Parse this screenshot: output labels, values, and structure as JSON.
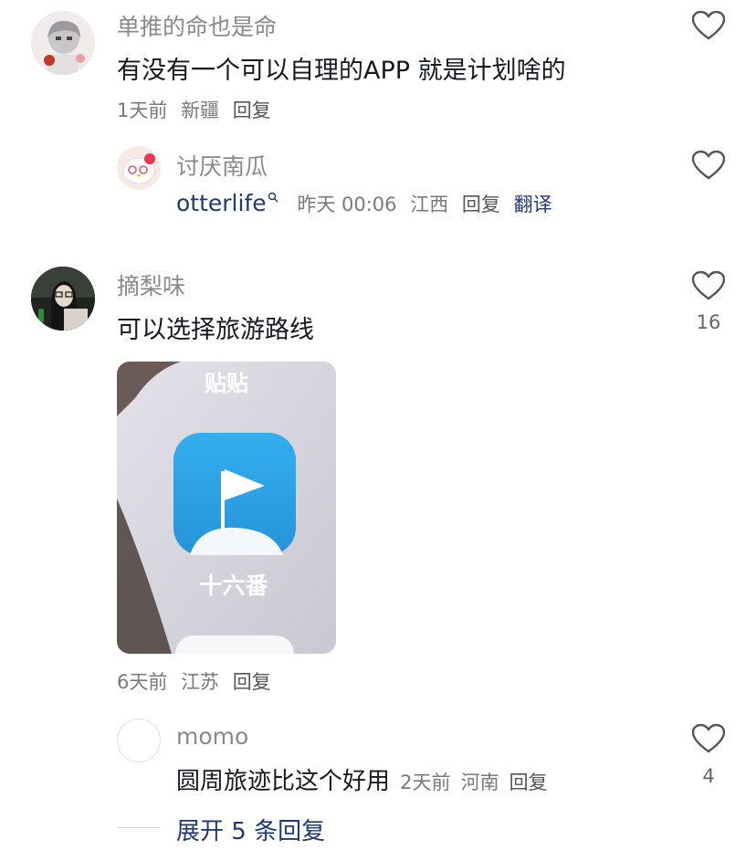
{
  "comments": [
    {
      "username": "单推的命也是命",
      "text": "有没有一个可以自理的APP 就是计划啥的",
      "time": "1天前",
      "location": "新疆",
      "reply_label": "回复",
      "reply": {
        "username": "讨厌南瓜",
        "mention": "otterlife",
        "time": "昨天 00:06",
        "location": "江西",
        "reply_label": "回复",
        "translate_label": "翻译"
      }
    },
    {
      "username": "摘梨味",
      "text": "可以选择旅游路线",
      "like_count": "16",
      "time": "6天前",
      "location": "江苏",
      "reply_label": "回复",
      "image": {
        "top_label": "贴贴",
        "app_name": "十六番"
      },
      "reply": {
        "username": "momo",
        "text": "圆周旅迹比这个好用",
        "time": "2天前",
        "location": "河南",
        "reply_label": "回复",
        "like_count": "4"
      },
      "expand_label": "展开 5 条回复"
    }
  ],
  "colors": {
    "link": "#1e3a6e",
    "app_icon": "#2fa6e8"
  }
}
